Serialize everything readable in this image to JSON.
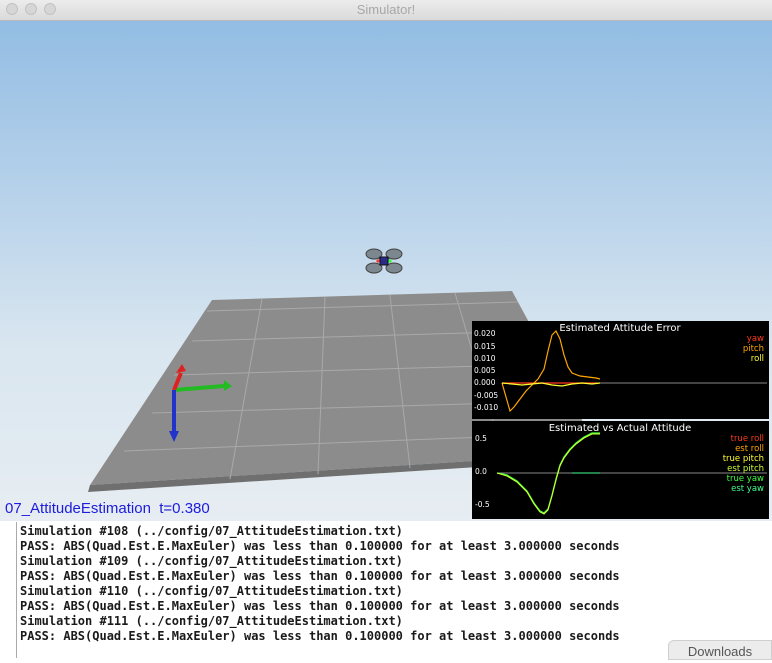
{
  "window": {
    "title": "Simulator!"
  },
  "scene": {
    "label": "07_AttitudeEstimation  t=0.380"
  },
  "plot_error": {
    "title": "Estimated Attitude Error",
    "legend": [
      {
        "label": "yaw",
        "color": "#ff3a1a"
      },
      {
        "label": "pitch",
        "color": "#ffa500"
      },
      {
        "label": "roll",
        "color": "#ffff30"
      }
    ],
    "ticks": [
      "0.020",
      "0.015",
      "0.010",
      "0.005",
      "0.000",
      "-0.005",
      "-0.010"
    ]
  },
  "plot_attitude": {
    "title": "Estimated vs Actual Attitude",
    "legend": [
      {
        "label": "true roll",
        "color": "#ff3a1a"
      },
      {
        "label": "est roll",
        "color": "#ffa500"
      },
      {
        "label": "true pitch",
        "color": "#ffff30"
      },
      {
        "label": "est pitch",
        "color": "#ccff30"
      },
      {
        "label": "true yaw",
        "color": "#40ff40"
      },
      {
        "label": "est yaw",
        "color": "#40ff90"
      }
    ],
    "ticks": [
      "0.5",
      "0.0",
      "-0.5"
    ]
  },
  "console": {
    "lines": [
      "Simulation #108 (../config/07_AttitudeEstimation.txt)",
      "PASS: ABS(Quad.Est.E.MaxEuler) was less than 0.100000 for at least 3.000000 seconds",
      "Simulation #109 (../config/07_AttitudeEstimation.txt)",
      "PASS: ABS(Quad.Est.E.MaxEuler) was less than 0.100000 for at least 3.000000 seconds",
      "Simulation #110 (../config/07_AttitudeEstimation.txt)",
      "PASS: ABS(Quad.Est.E.MaxEuler) was less than 0.100000 for at least 3.000000 seconds",
      "Simulation #111 (../config/07_AttitudeEstimation.txt)",
      "PASS: ABS(Quad.Est.E.MaxEuler) was less than 0.100000 for at least 3.000000 seconds"
    ]
  },
  "downloads": {
    "label": "Downloads"
  }
}
